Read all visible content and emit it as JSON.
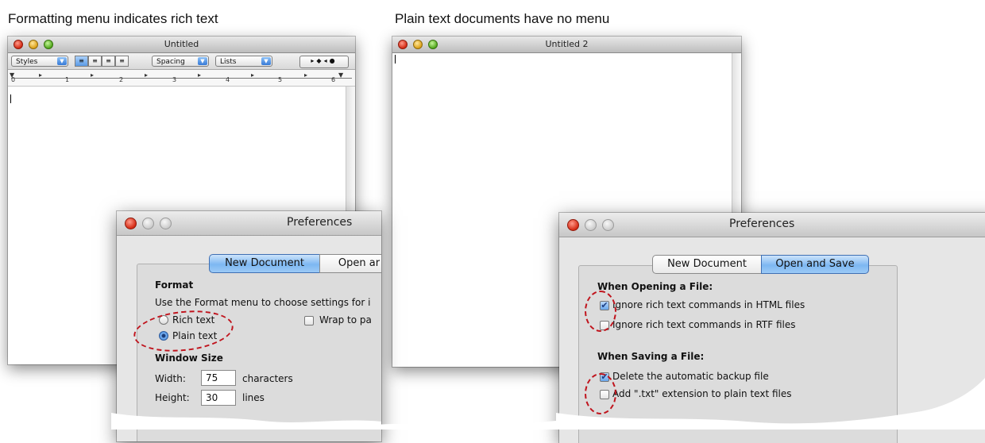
{
  "captions": {
    "left": "Formatting menu indicates rich text",
    "right": "Plain text documents have no menu"
  },
  "rich_window": {
    "title": "Untitled",
    "toolbar": {
      "styles": "Styles",
      "spacing": "Spacing",
      "lists": "Lists",
      "align_left": "≡",
      "align_center": "≡",
      "align_justify": "≡",
      "align_right": "≡",
      "nav": "▸◆◂●"
    },
    "ruler_numbers": [
      "0",
      "1",
      "2",
      "3",
      "4",
      "5",
      "6"
    ]
  },
  "plain_window": {
    "title": "Untitled 2"
  },
  "pref_left": {
    "title": "Preferences",
    "tabs": [
      "New Document",
      "Open ar"
    ],
    "format_heading": "Format",
    "format_desc": "Use the Format menu to choose settings for i",
    "rich_text": "Rich text",
    "plain_text": "Plain text",
    "wrap": "Wrap to pa",
    "window_size": "Window Size",
    "width_label": "Width:",
    "width_value": "75",
    "width_unit": "characters",
    "height_label": "Height:",
    "height_value": "30",
    "height_unit": "lines"
  },
  "pref_right": {
    "title": "Preferences",
    "tabs": [
      "New Document",
      "Open and Save"
    ],
    "opening_heading": "When Opening a File:",
    "ignore_html": "Ignore rich text commands in HTML files",
    "ignore_rtf": "Ignore rich text commands in RTF files",
    "saving_heading": "When Saving a File:",
    "delete_backup": "Delete the automatic backup file",
    "add_txt": "Add \".txt\" extension to plain text files"
  },
  "colors": {
    "annotation": "#c0141d",
    "selection": "#5b9be6"
  }
}
